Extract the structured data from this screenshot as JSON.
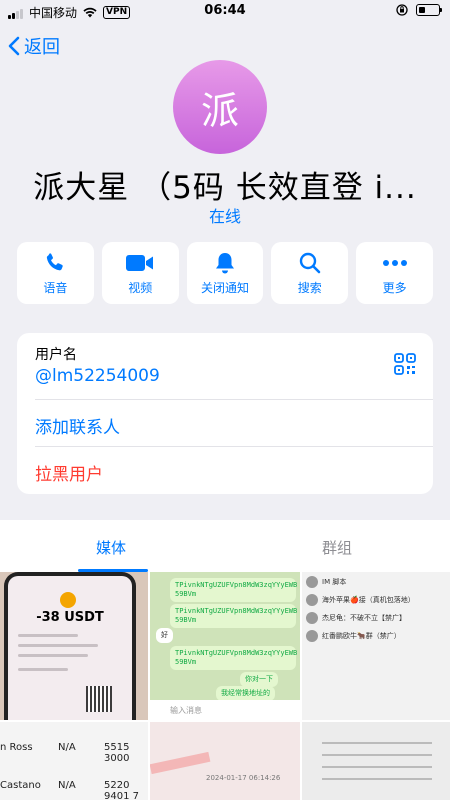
{
  "status_bar": {
    "carrier": "中国移动",
    "vpn": "VPN",
    "time": "06:44"
  },
  "nav": {
    "back_label": "返回"
  },
  "profile": {
    "avatar_char": "派",
    "name": "派大星 （5码 长效直登 i...",
    "status": "在线",
    "avatar_color": "#d47ae3"
  },
  "actions": [
    {
      "label": "语音",
      "icon": "phone-icon"
    },
    {
      "label": "视频",
      "icon": "video-camera-icon"
    },
    {
      "label": "关闭通知",
      "icon": "bell-icon"
    },
    {
      "label": "搜索",
      "icon": "search-icon"
    },
    {
      "label": "更多",
      "icon": "more-dots-icon"
    }
  ],
  "info": {
    "username_label": "用户名",
    "username": "@lm52254009",
    "add_contact": "添加联系人",
    "block_user": "拉黑用户"
  },
  "tabs": {
    "media": "媒体",
    "groups": "群组"
  },
  "media": {
    "cell1": {
      "amount": "-38 USDT"
    },
    "cell2": {
      "messages": [
        "TPivnkNTgUZUFVpn8MdW3zqYYyEWB\n59BVm",
        "TPivnkNTgUZUFVpn8MdW3zqYYyEWB\n59BVm",
        "好",
        "TPivnkNTgUZUFVpn8MdW3zqYYyEWB\n59BVm",
        "你对一下",
        "我经常换地址的"
      ],
      "input_placeholder": "输入消息"
    },
    "cell3": {
      "items": [
        "IM 脚本",
        "海外苹果🍎接（真机包落地）",
        "杰尼龟：不破不立【禁广】",
        "红番鹏欧牛🐂群（禁广）"
      ]
    },
    "cell4": {
      "texts": [
        "n Ross",
        "N/A",
        "5515 3000",
        "Castano",
        "N/A",
        "5220 9401 7"
      ]
    },
    "cell5": {
      "texts": [
        "2024-01-17 06:14:26"
      ]
    }
  },
  "colors": {
    "accent": "#007aff",
    "danger": "#ff3b30",
    "background": "#efeff4"
  }
}
